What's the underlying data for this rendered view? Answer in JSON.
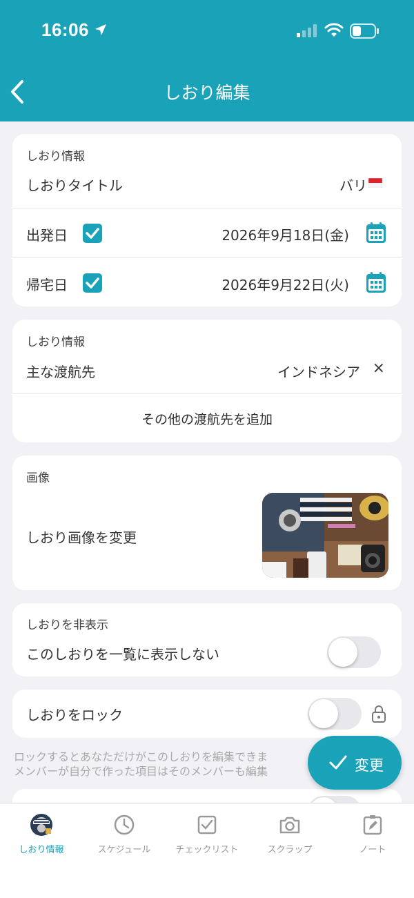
{
  "status_bar": {
    "time": "16:06"
  },
  "header": {
    "title": "しおり編集"
  },
  "card_title": {
    "section_label": "しおり情報",
    "title_label": "しおりタイトル",
    "title_value": "バリ",
    "departure_label": "出発日",
    "departure_checked": true,
    "departure_date": "2026年9月18日(金)",
    "return_label": "帰宅日",
    "return_checked": true,
    "return_date": "2026年9月22日(火)"
  },
  "card_destination": {
    "section_label": "しおり情報",
    "main_dest_label": "主な渡航先",
    "main_dest_value": "インドネシア",
    "remove_symbol": "×",
    "add_other_label": "その他の渡航先を追加"
  },
  "card_image": {
    "section_label": "画像",
    "change_label": "しおり画像を変更"
  },
  "card_hide": {
    "section_label": "しおりを非表示",
    "toggle_label": "このしおりを一覧に表示しない",
    "toggle_on": false
  },
  "card_lock": {
    "toggle_label": "しおりをロック",
    "toggle_on": false
  },
  "lock_note": {
    "line1": "ロックするとあなただけがこのしおりを編集できま",
    "line2": "メンバーが自分で作った項目はそのメンバーも編集"
  },
  "fab": {
    "label": "変更"
  },
  "tabbar": {
    "active_index": 0,
    "tabs": [
      {
        "label": "しおり情報",
        "icon": "avatar-icon"
      },
      {
        "label": "スケジュール",
        "icon": "clock-icon"
      },
      {
        "label": "チェックリスト",
        "icon": "checkbox-icon"
      },
      {
        "label": "スクラップ",
        "icon": "camera-icon"
      },
      {
        "label": "ノート",
        "icon": "note-edit-icon"
      }
    ]
  },
  "colors": {
    "accent": "#1aa3b8",
    "background": "#f1f1f6",
    "card": "#ffffff"
  }
}
